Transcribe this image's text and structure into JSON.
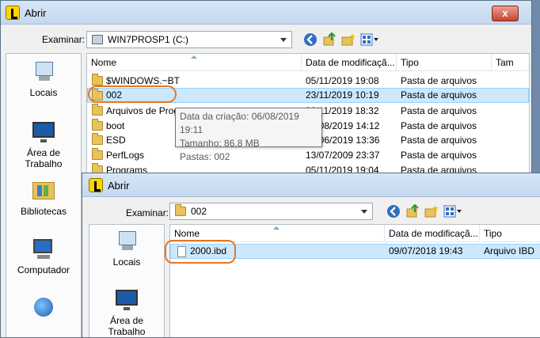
{
  "dialog1": {
    "title": "Abrir",
    "close": "x",
    "examinar_label": "Examinar:",
    "location": "WIN7PROSP1 (C:)",
    "places": [
      "Locais",
      "Área de Trabalho",
      "Bibliotecas",
      "Computador"
    ],
    "columns": [
      "Nome",
      "Data de modificaçã...",
      "Tipo",
      "Tam"
    ],
    "rows": [
      {
        "name": "$WINDOWS.~BT",
        "date": "05/11/2019 19:08",
        "type": "Pasta de arquivos"
      },
      {
        "name": "002",
        "date": "23/11/2019 10:19",
        "type": "Pasta de arquivos"
      },
      {
        "name": "Arquivos de Programas",
        "date": "23/11/2019 18:32",
        "type": "Pasta de arquivos"
      },
      {
        "name": "boot",
        "date": "21/08/2019 14:12",
        "type": "Pasta de arquivos"
      },
      {
        "name": "ESD",
        "date": "24/06/2019 13:36",
        "type": "Pasta de arquivos"
      },
      {
        "name": "PerfLogs",
        "date": "13/07/2009 23:37",
        "type": "Pasta de arquivos"
      },
      {
        "name": "Programs",
        "date": "05/11/2019 19:04",
        "type": "Pasta de arquivos"
      }
    ],
    "tooltip": [
      "Data da criação: 06/08/2019 19:11",
      "Tamanho: 86,8 MB",
      "Pastas: 002"
    ]
  },
  "dialog2": {
    "title": "Abrir",
    "examinar_label": "Examinar:",
    "location": "002",
    "places": [
      "Locais",
      "Área de Trabalho"
    ],
    "columns": [
      "Nome",
      "Data de modificaçã...",
      "Tipo"
    ],
    "rows": [
      {
        "name": "2000.ibd",
        "date": "09/07/2018 19:43",
        "type": "Arquivo IBD"
      }
    ]
  },
  "colors": {
    "accent_orange": "#e8761e",
    "selection": "#cce8ff"
  }
}
